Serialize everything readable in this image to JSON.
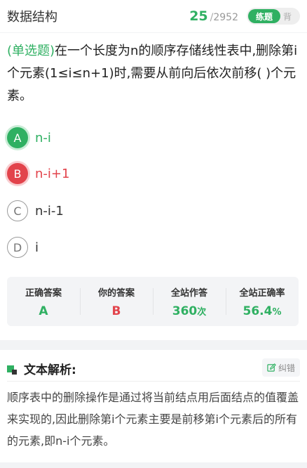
{
  "header": {
    "title": "数据结构",
    "current": "25",
    "separator": "/",
    "total": "2952",
    "mode_active": "练题",
    "mode_inactive": "背"
  },
  "question": {
    "type": "(单选题)",
    "text": "在一个长度为n的顺序存储线性表中,删除第i个元素(1≤i≤n+1)时,需要从前向后依次前移(      )个元素。"
  },
  "options": [
    {
      "letter": "A",
      "text": "n-i",
      "state": "correct"
    },
    {
      "letter": "B",
      "text": "n-i+1",
      "state": "wrong"
    },
    {
      "letter": "C",
      "text": "n-i-1",
      "state": "normal"
    },
    {
      "letter": "D",
      "text": "i",
      "state": "normal"
    }
  ],
  "stats": {
    "correct_label": "正确答案",
    "correct_value": "A",
    "yours_label": "你的答案",
    "yours_value": "B",
    "total_label": "全站作答",
    "total_value": "360",
    "total_unit": "次",
    "rate_label": "全站正确率",
    "rate_value": "56.4",
    "rate_unit": "%"
  },
  "analysis": {
    "title": "文本解析:",
    "correct_btn": "纠错",
    "text": "顺序表中的删除操作是通过将当前结点用后面结点的值覆盖来实现的,因此删除第i个元素主要是前移第i个元素后的所有的元素,即n-i个元素。"
  },
  "colors": {
    "accent": "#2fb062",
    "error": "#e2434b"
  }
}
